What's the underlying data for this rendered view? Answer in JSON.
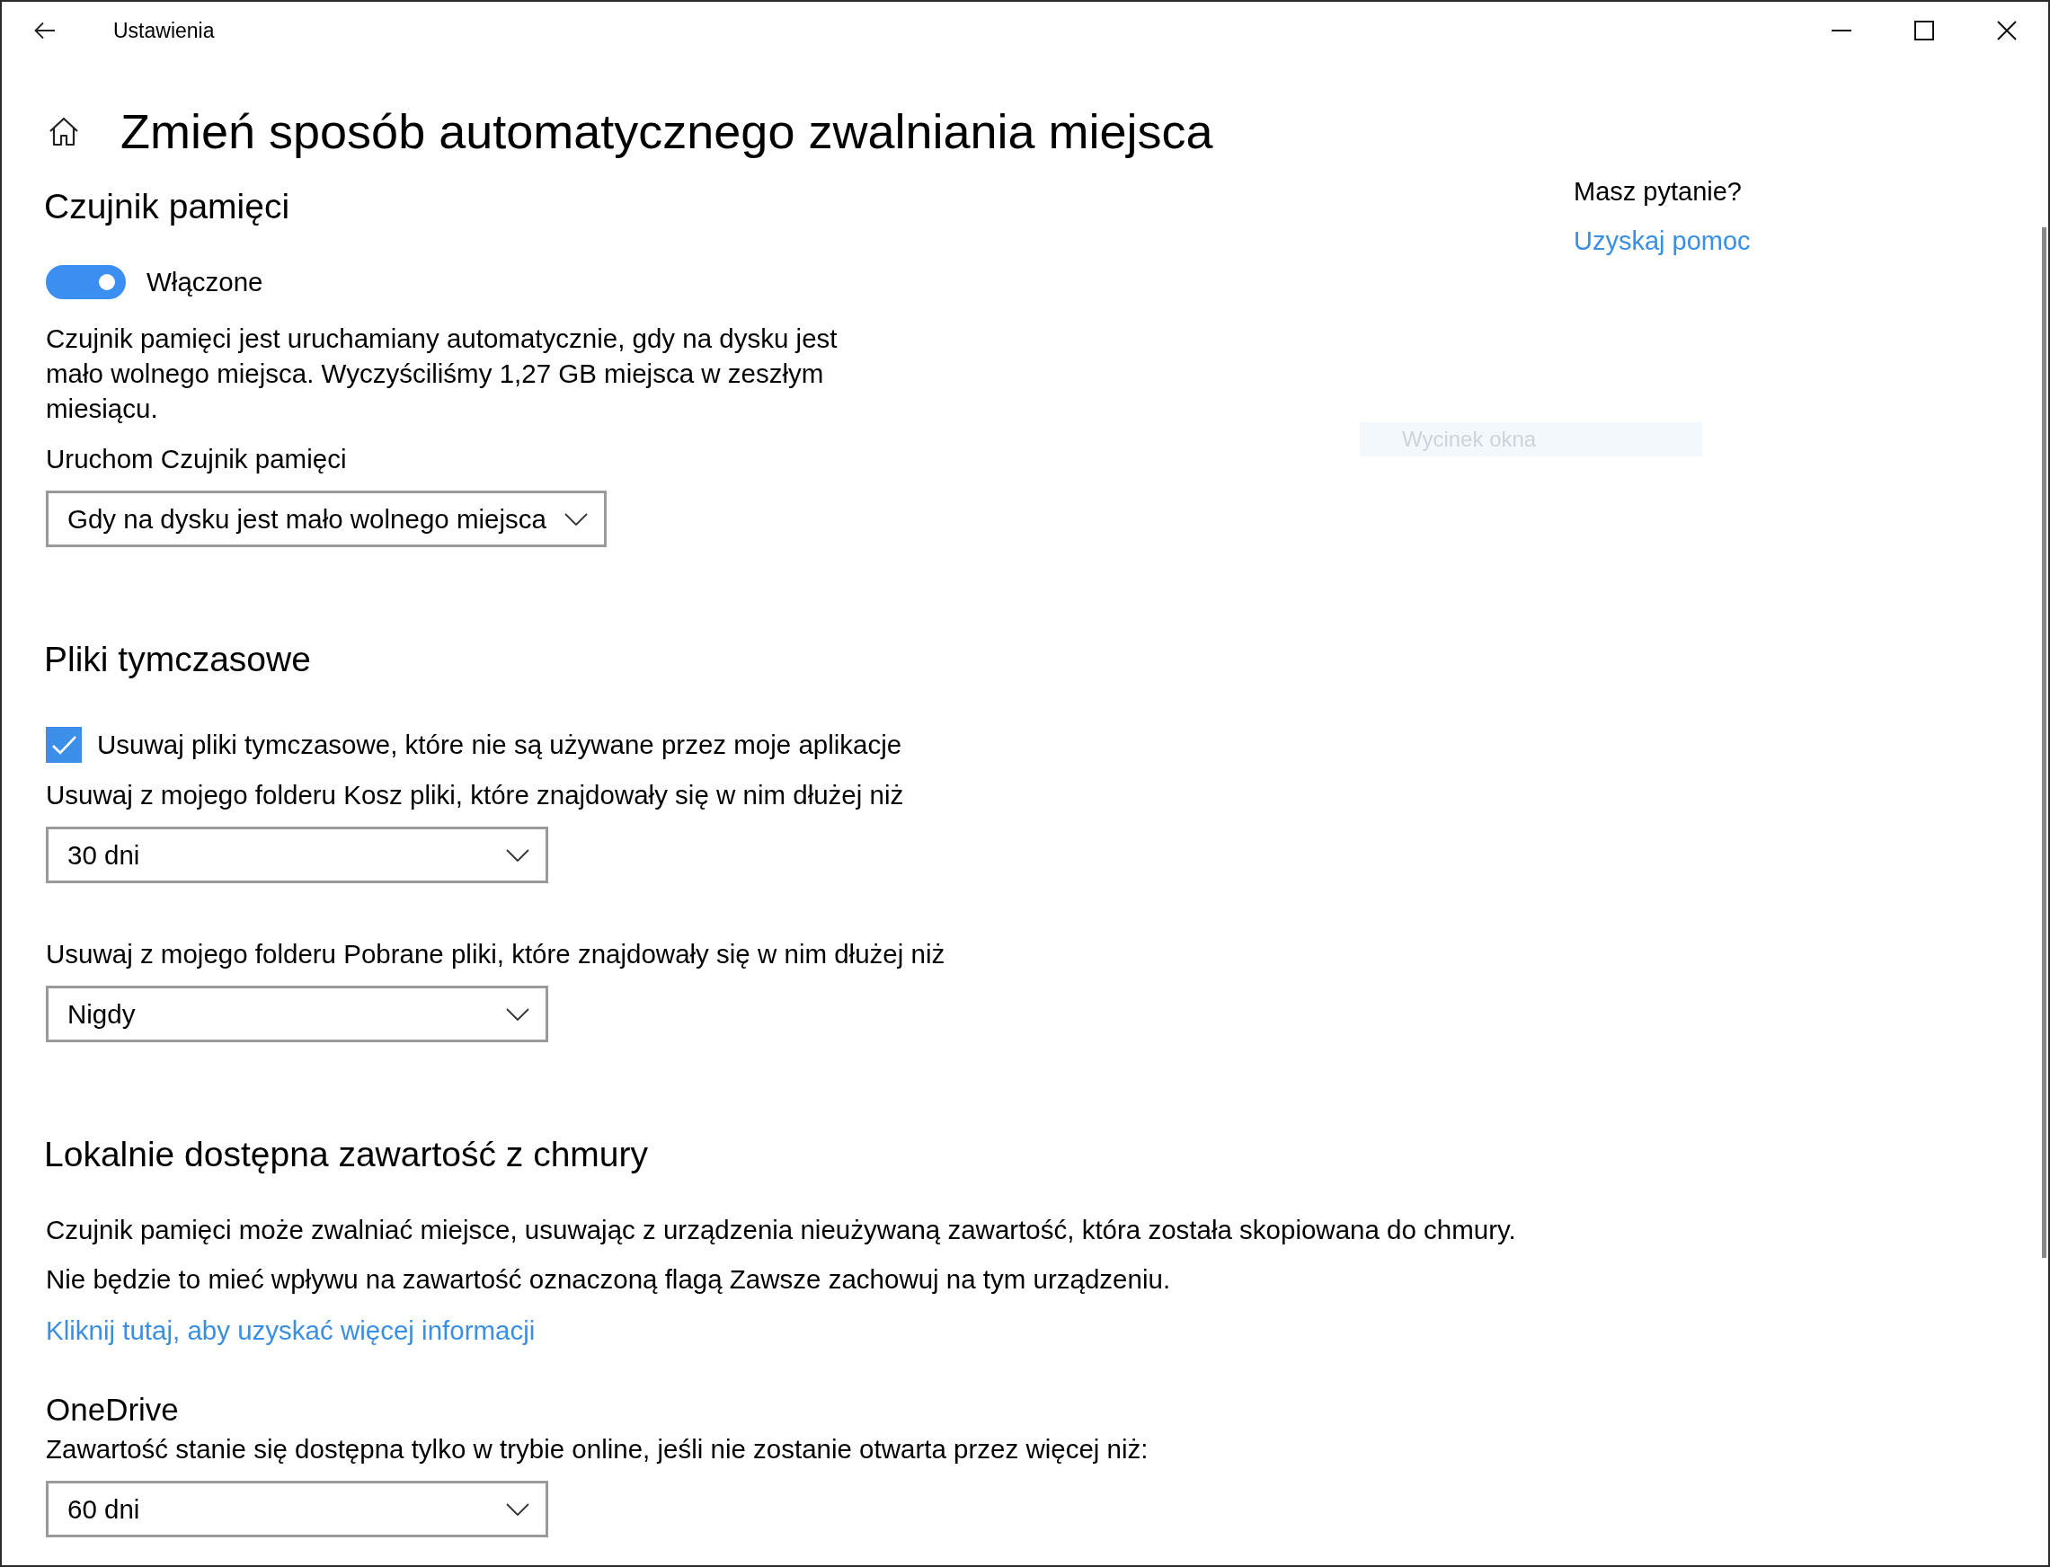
{
  "window": {
    "title": "Ustawienia"
  },
  "page": {
    "title": "Zmień sposób automatycznego zwalniania miejsca"
  },
  "help": {
    "question": "Masz pytanie?",
    "link": "Uzyskaj pomoc"
  },
  "tooltip": {
    "text": "Wycinek okna"
  },
  "sections": [
    {
      "heading": "Czujnik pamięci",
      "items": [
        {
          "kind": "toggle",
          "label": "Włączone",
          "on": true
        },
        {
          "kind": "description",
          "text": "Czujnik pamięci jest uruchamiany automatycznie, gdy na dysku jest mało wolnego miejsca. Wyczyściliśmy 1,27 GB miejsca w zeszłym miesiącu."
        },
        {
          "kind": "dropdown",
          "label": "Uruchom Czujnik pamięci",
          "value": "Gdy na dysku jest mało wolnego miejsca"
        }
      ]
    },
    {
      "heading": "Pliki tymczasowe",
      "items": [
        {
          "kind": "checkbox",
          "label": "Usuwaj pliki tymczasowe, które nie są używane przez moje aplikacje",
          "checked": true
        },
        {
          "kind": "dropdown",
          "label": "Usuwaj z mojego folderu Kosz pliki, które znajdowały się w nim dłużej niż",
          "value": "30 dni"
        },
        {
          "kind": "dropdown",
          "label": "Usuwaj z mojego folderu Pobrane pliki, które znajdowały się w nim dłużej niż",
          "value": "Nigdy"
        }
      ]
    },
    {
      "heading": "Lokalnie dostępna zawartość z chmury",
      "items": [
        {
          "kind": "paragraph",
          "text": "Czujnik pamięci może zwalniać miejsce, usuwając z urządzenia nieużywaną zawartość, która została skopiowana do chmury."
        },
        {
          "kind": "paragraph",
          "text": "Nie będzie to mieć wpływu na zawartość oznaczoną flagą Zawsze zachowuj na tym urządzeniu."
        },
        {
          "kind": "link",
          "text": "Kliknij tutaj, aby uzyskać więcej informacji"
        },
        {
          "kind": "subheading",
          "text": "OneDrive"
        },
        {
          "kind": "dropdown",
          "label": "Zawartość stanie się dostępna tylko w trybie online, jeśli nie zostanie otwarta przez więcej niż:",
          "value": "60 dni"
        }
      ]
    }
  ]
}
